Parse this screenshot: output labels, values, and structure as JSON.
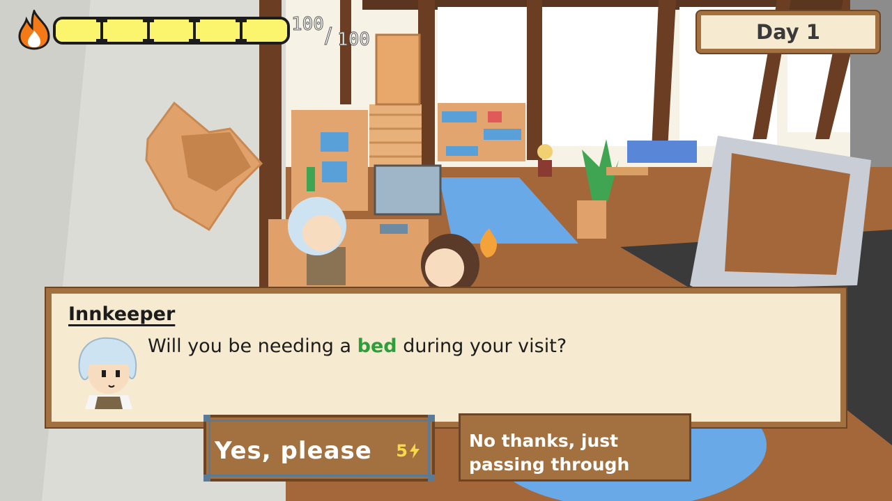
{
  "hud": {
    "energy_current": "100",
    "energy_separator": "/",
    "energy_max": "100",
    "energy_fraction": 1.0,
    "energy_segments": 5,
    "icon": "flame-icon",
    "flame_color": "#f47a18"
  },
  "day": {
    "label": "Day 1"
  },
  "dialog": {
    "speaker": "Innkeeper",
    "message_before": "Will you be needing a ",
    "message_highlight": "bed",
    "message_after": " during your visit?",
    "highlight_color": "#2e9e3a"
  },
  "choices": {
    "yes": {
      "label": "Yes, please",
      "cost": "5",
      "cost_icon": "lightning-icon"
    },
    "no": {
      "label_line1": "No thanks, just",
      "label_line2": "passing through"
    }
  },
  "colors": {
    "panel_bg": "#f6ebd0",
    "panel_border": "#a3713f",
    "button_bg": "#a3713f",
    "energy_bar": "#fbf56e",
    "cost_color": "#f6d84a"
  }
}
